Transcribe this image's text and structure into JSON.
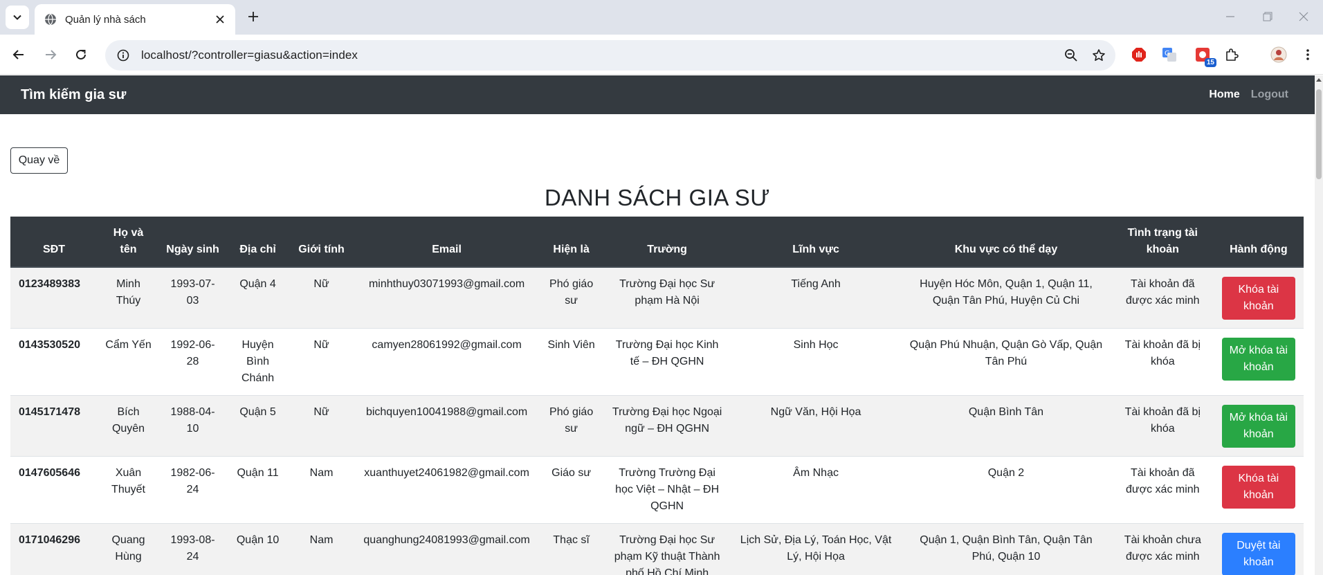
{
  "browser": {
    "tab_title": "Quản lý nhà sách",
    "url": "localhost/?controller=giasu&action=index",
    "extension_badge": "15"
  },
  "navbar": {
    "brand": "Tìm kiếm gia sư",
    "home": "Home",
    "logout": "Logout"
  },
  "page": {
    "back_button": "Quay về",
    "title": "DANH SÁCH GIA SƯ"
  },
  "table": {
    "headers": [
      "SĐT",
      "Họ và tên",
      "Ngày sinh",
      "Địa chỉ",
      "Giới tính",
      "Email",
      "Hiện là",
      "Trường",
      "Lĩnh vực",
      "Khu vực có thể dạy",
      "Tình trạng tài khoản",
      "Hành động"
    ],
    "rows": [
      {
        "phone": "0123489383",
        "name": "Minh Thúy",
        "dob": "1993-07-03",
        "address": "Quận 4",
        "gender": "Nữ",
        "email": "minhthuy03071993@gmail.com",
        "position": "Phó giáo sư",
        "school": "Trường Đại học Sư phạm Hà Nội",
        "field": "Tiếng Anh",
        "areas": "Huyện Hóc Môn, Quận 1, Quận 11, Quận Tân Phú, Huyện Củ Chi",
        "status": "Tài khoản đã được xác minh",
        "action": "Khóa tài khoản",
        "action_color": "red"
      },
      {
        "phone": "0143530520",
        "name": "Cẩm Yến",
        "dob": "1992-06-28",
        "address": "Huyện Bình Chánh",
        "gender": "Nữ",
        "email": "camyen28061992@gmail.com",
        "position": "Sinh Viên",
        "school": "Trường Đại học Kinh tế – ĐH QGHN",
        "field": "Sinh Học",
        "areas": "Quận Phú Nhuận, Quận Gò Vấp, Quận Tân Phú",
        "status": "Tài khoản đã bị khóa",
        "action": "Mở khóa tài khoản",
        "action_color": "green"
      },
      {
        "phone": "0145171478",
        "name": "Bích Quyên",
        "dob": "1988-04-10",
        "address": "Quận 5",
        "gender": "Nữ",
        "email": "bichquyen10041988@gmail.com",
        "position": "Phó giáo sư",
        "school": "Trường Đại học Ngoại ngữ – ĐH QGHN",
        "field": "Ngữ Văn, Hội Họa",
        "areas": "Quận Bình Tân",
        "status": "Tài khoản đã bị khóa",
        "action": "Mở khóa tài khoản",
        "action_color": "green"
      },
      {
        "phone": "0147605646",
        "name": "Xuân Thuyết",
        "dob": "1982-06-24",
        "address": "Quận 11",
        "gender": "Nam",
        "email": "xuanthuyet24061982@gmail.com",
        "position": "Giáo sư",
        "school": "Trường Trường Đại học Việt – Nhật – ĐH QGHN",
        "field": "Âm Nhạc",
        "areas": "Quận 2",
        "status": "Tài khoản đã được xác minh",
        "action": "Khóa tài khoản",
        "action_color": "red"
      },
      {
        "phone": "0171046296",
        "name": "Quang Hùng",
        "dob": "1993-08-24",
        "address": "Quận 10",
        "gender": "Nam",
        "email": "quanghung24081993@gmail.com",
        "position": "Thạc sĩ",
        "school": "Trường Đại học Sư phạm Kỹ thuật Thành phố Hồ Chí Minh",
        "field": "Lịch Sử, Địa Lý, Toán Học, Vật Lý, Hội Họa",
        "areas": "Quận 1, Quận Bình Tân, Quận Tân Phú, Quận 10",
        "status": "Tài khoản chưa được xác minh",
        "action": "Duyệt tài khoản",
        "action_color": "blue"
      }
    ]
  }
}
